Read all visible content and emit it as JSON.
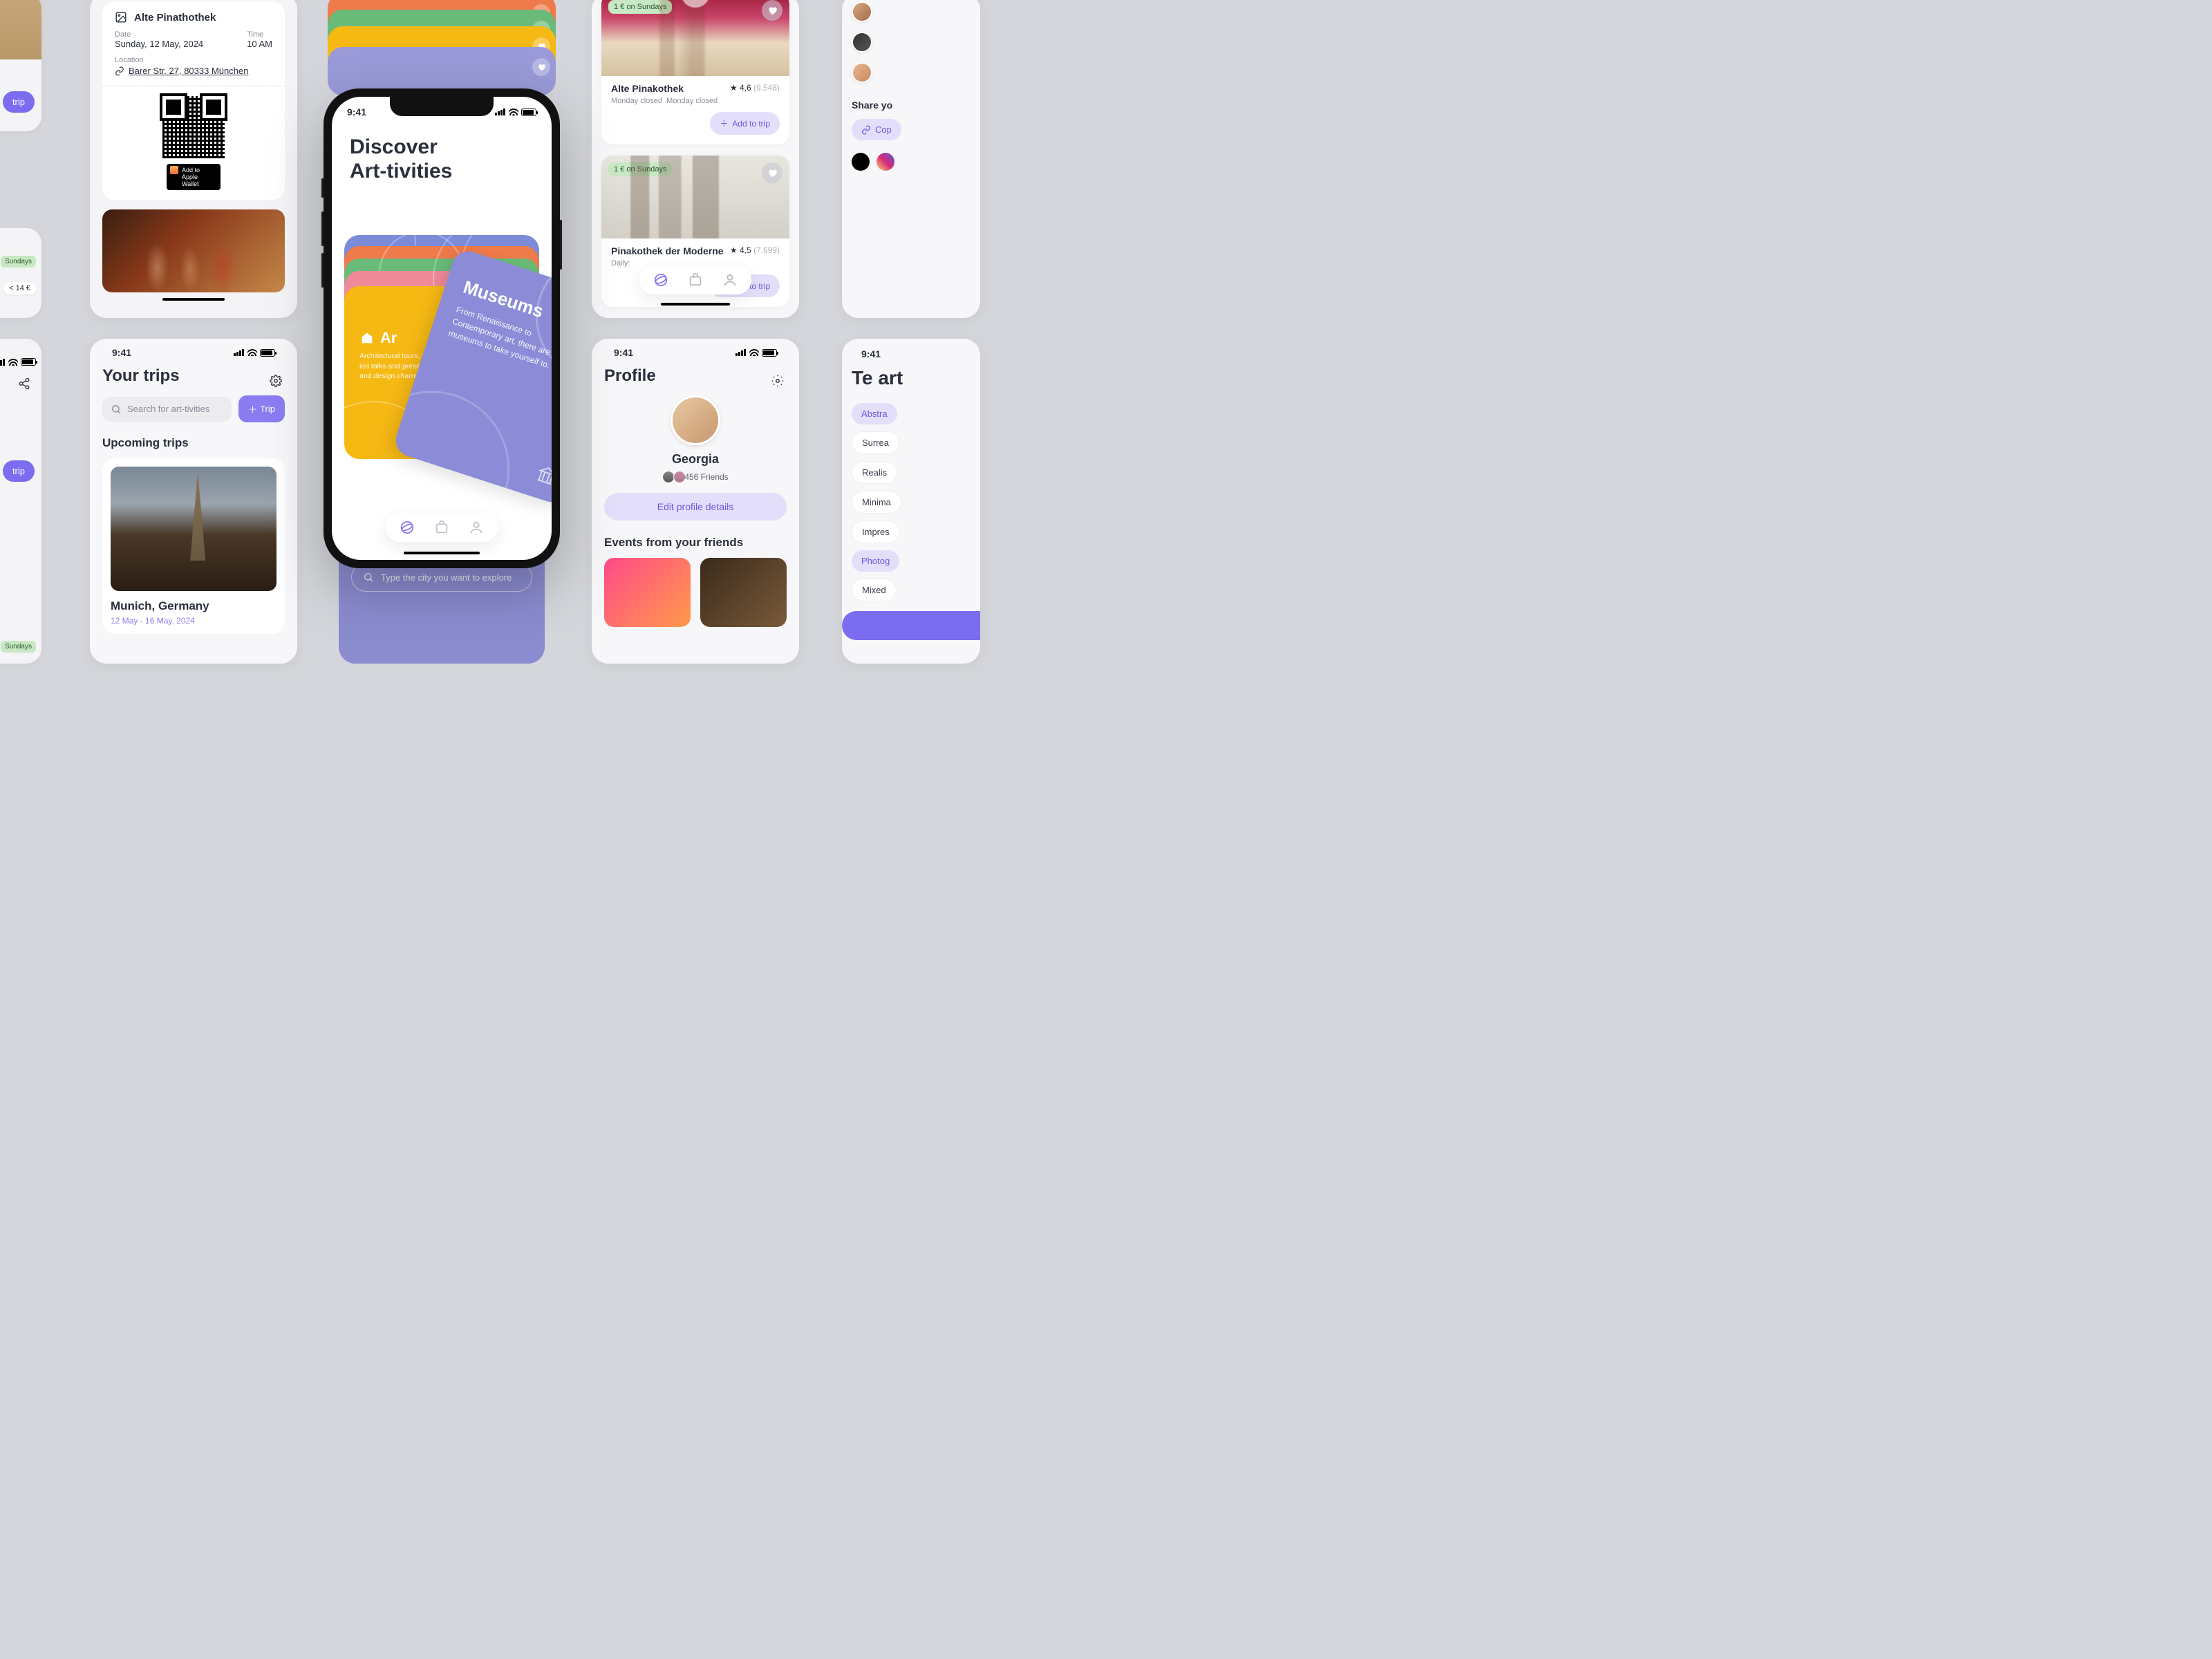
{
  "status_time": "9:41",
  "ticket": {
    "venue": "Alte Pinathothek",
    "date_label": "Date",
    "date_value": "Sunday, 12 May, 2024",
    "time_label": "Time",
    "time_value": "10 AM",
    "location_label": "Location",
    "location_value": "Barer Str. 27, 80333 München",
    "wallet_label": "Add to Apple Wallet"
  },
  "edge": {
    "trip_btn": "trip",
    "sundays_tag": "Sundays",
    "price_tag": "< 14 €"
  },
  "museums": {
    "badge": "1 € on Sundays",
    "add_trip": "Add to trip",
    "items": [
      {
        "name": "Alte Pinakothek",
        "rating": "4,6",
        "count": "(9.548)",
        "hours1": "Monday closed",
        "hours2": "Monday closed"
      },
      {
        "name": "Pinakothek der Moderne",
        "rating": "4,5",
        "count": "(7.699)",
        "hours1": "Daily:"
      }
    ]
  },
  "share": {
    "heading": "Share yo",
    "copy": "Cop"
  },
  "trips": {
    "title": "Your trips",
    "search_placeholder": "Search for art-tivities",
    "new_trip": "Trip",
    "subheading": "Upcoming trips",
    "card": {
      "city": "Munich, Germany",
      "dates": "12 May - 16 May, 2024"
    }
  },
  "discover": {
    "title_l1": "Discover",
    "title_l2": "Art-tivities",
    "arch_title": "Ar",
    "arch_body": "Architectural tours, ex\narchitect-led talks and prese\ncompetitions and design charrettes",
    "museums_title": "Museums",
    "museums_body": "From Renaissance to Contemporary art, there are many museums to take yourself to."
  },
  "city_search": {
    "placeholder": "Type the city you want to explore"
  },
  "profile": {
    "title": "Profile",
    "name": "Georgia",
    "friends": "456 Friends",
    "edit": "Edit profile details",
    "events_heading": "Events from your friends"
  },
  "tags": {
    "heading": "Te\nart",
    "items": [
      "Abstra",
      "Surrea",
      "Realis",
      "Minima",
      "Impres",
      "Photog",
      "Mixed"
    ]
  }
}
